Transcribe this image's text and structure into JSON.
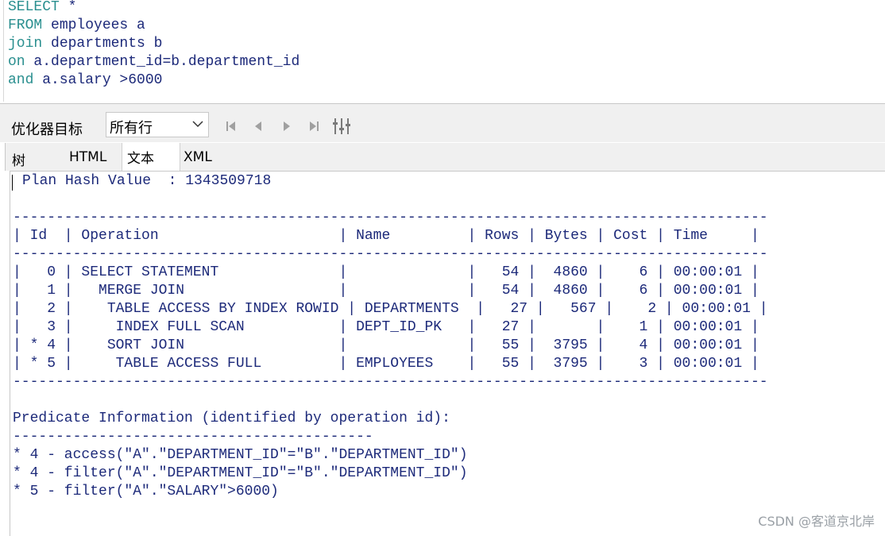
{
  "sql": {
    "lines": [
      {
        "kw": "SELECT",
        "rest": " *"
      },
      {
        "kw": "FROM",
        "rest": " employees a"
      },
      {
        "kw": "join",
        "rest": " departments b"
      },
      {
        "kw": "on",
        "rest": " a.department_id=b.department_id"
      },
      {
        "kw": "and",
        "rest": " a.salary >6000"
      }
    ]
  },
  "toolbar": {
    "optimizer_label": "优化器目标",
    "optimizer_value": "所有行"
  },
  "tabs": [
    {
      "label": "树"
    },
    {
      "label": "HTML"
    },
    {
      "label": "文本"
    },
    {
      "label": "XML"
    }
  ],
  "plan": {
    "hash_line": "Plan Hash Value  : 1343509718",
    "separator": "----------------------------------------------------------------------------------------",
    "header": "| Id  | Operation                     | Name         | Rows | Bytes | Cost | Time     |",
    "rows": [
      "|   0 | SELECT STATEMENT              |              |   54 |  4860 |    6 | 00:00:01 |",
      "|   1 |   MERGE JOIN                  |              |   54 |  4860 |    6 | 00:00:01 |",
      "|   2 |    TABLE ACCESS BY INDEX ROWID | DEPARTMENTS  |   27 |   567 |    2 | 00:00:01 |",
      "|   3 |     INDEX FULL SCAN           | DEPT_ID_PK   |   27 |       |    1 | 00:00:01 |",
      "| * 4 |    SORT JOIN                  |              |   55 |  3795 |    4 | 00:00:01 |",
      "| * 5 |     TABLE ACCESS FULL         | EMPLOYEES    |   55 |  3795 |    3 | 00:00:01 |"
    ],
    "predicate_title": "Predicate Information (identified by operation id):",
    "predicate_separator": "------------------------------------------",
    "predicates": [
      "* 4 - access(\"A\".\"DEPARTMENT_ID\"=\"B\".\"DEPARTMENT_ID\")",
      "* 4 - filter(\"A\".\"DEPARTMENT_ID\"=\"B\".\"DEPARTMENT_ID\")",
      "* 5 - filter(\"A\".\"SALARY\">6000)"
    ]
  },
  "watermark": "CSDN @客道京北岸"
}
